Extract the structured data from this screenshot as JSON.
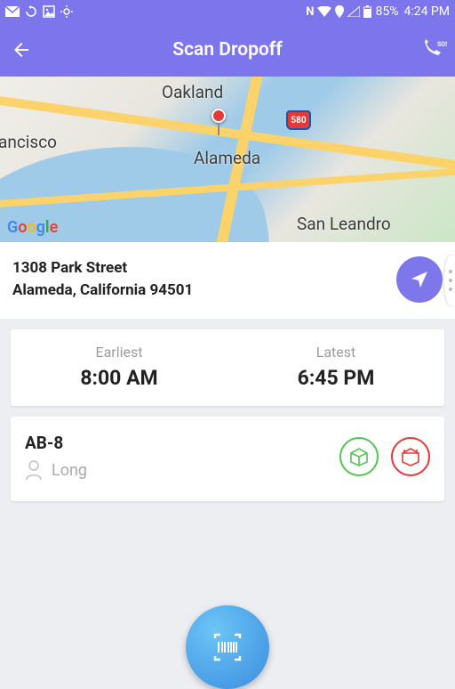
{
  "statusbar": {
    "battery_pct": "85%",
    "clock": "4:24 PM"
  },
  "appbar": {
    "title": "Scan Dropoff"
  },
  "map": {
    "city_oakland": "Oakland",
    "city_alameda": "Alameda",
    "city_sanleandro": "San Leandro",
    "city_sf_partial": "ancisco",
    "highway": "580",
    "attribution": "Google"
  },
  "address": {
    "line1": "1308 Park Street",
    "line2": "Alameda, California 94501"
  },
  "window": {
    "earliest_label": "Earliest",
    "earliest_value": "8:00 AM",
    "latest_label": "Latest",
    "latest_value": "6:45 PM"
  },
  "package": {
    "code": "AB-8",
    "recipient": "Long"
  }
}
